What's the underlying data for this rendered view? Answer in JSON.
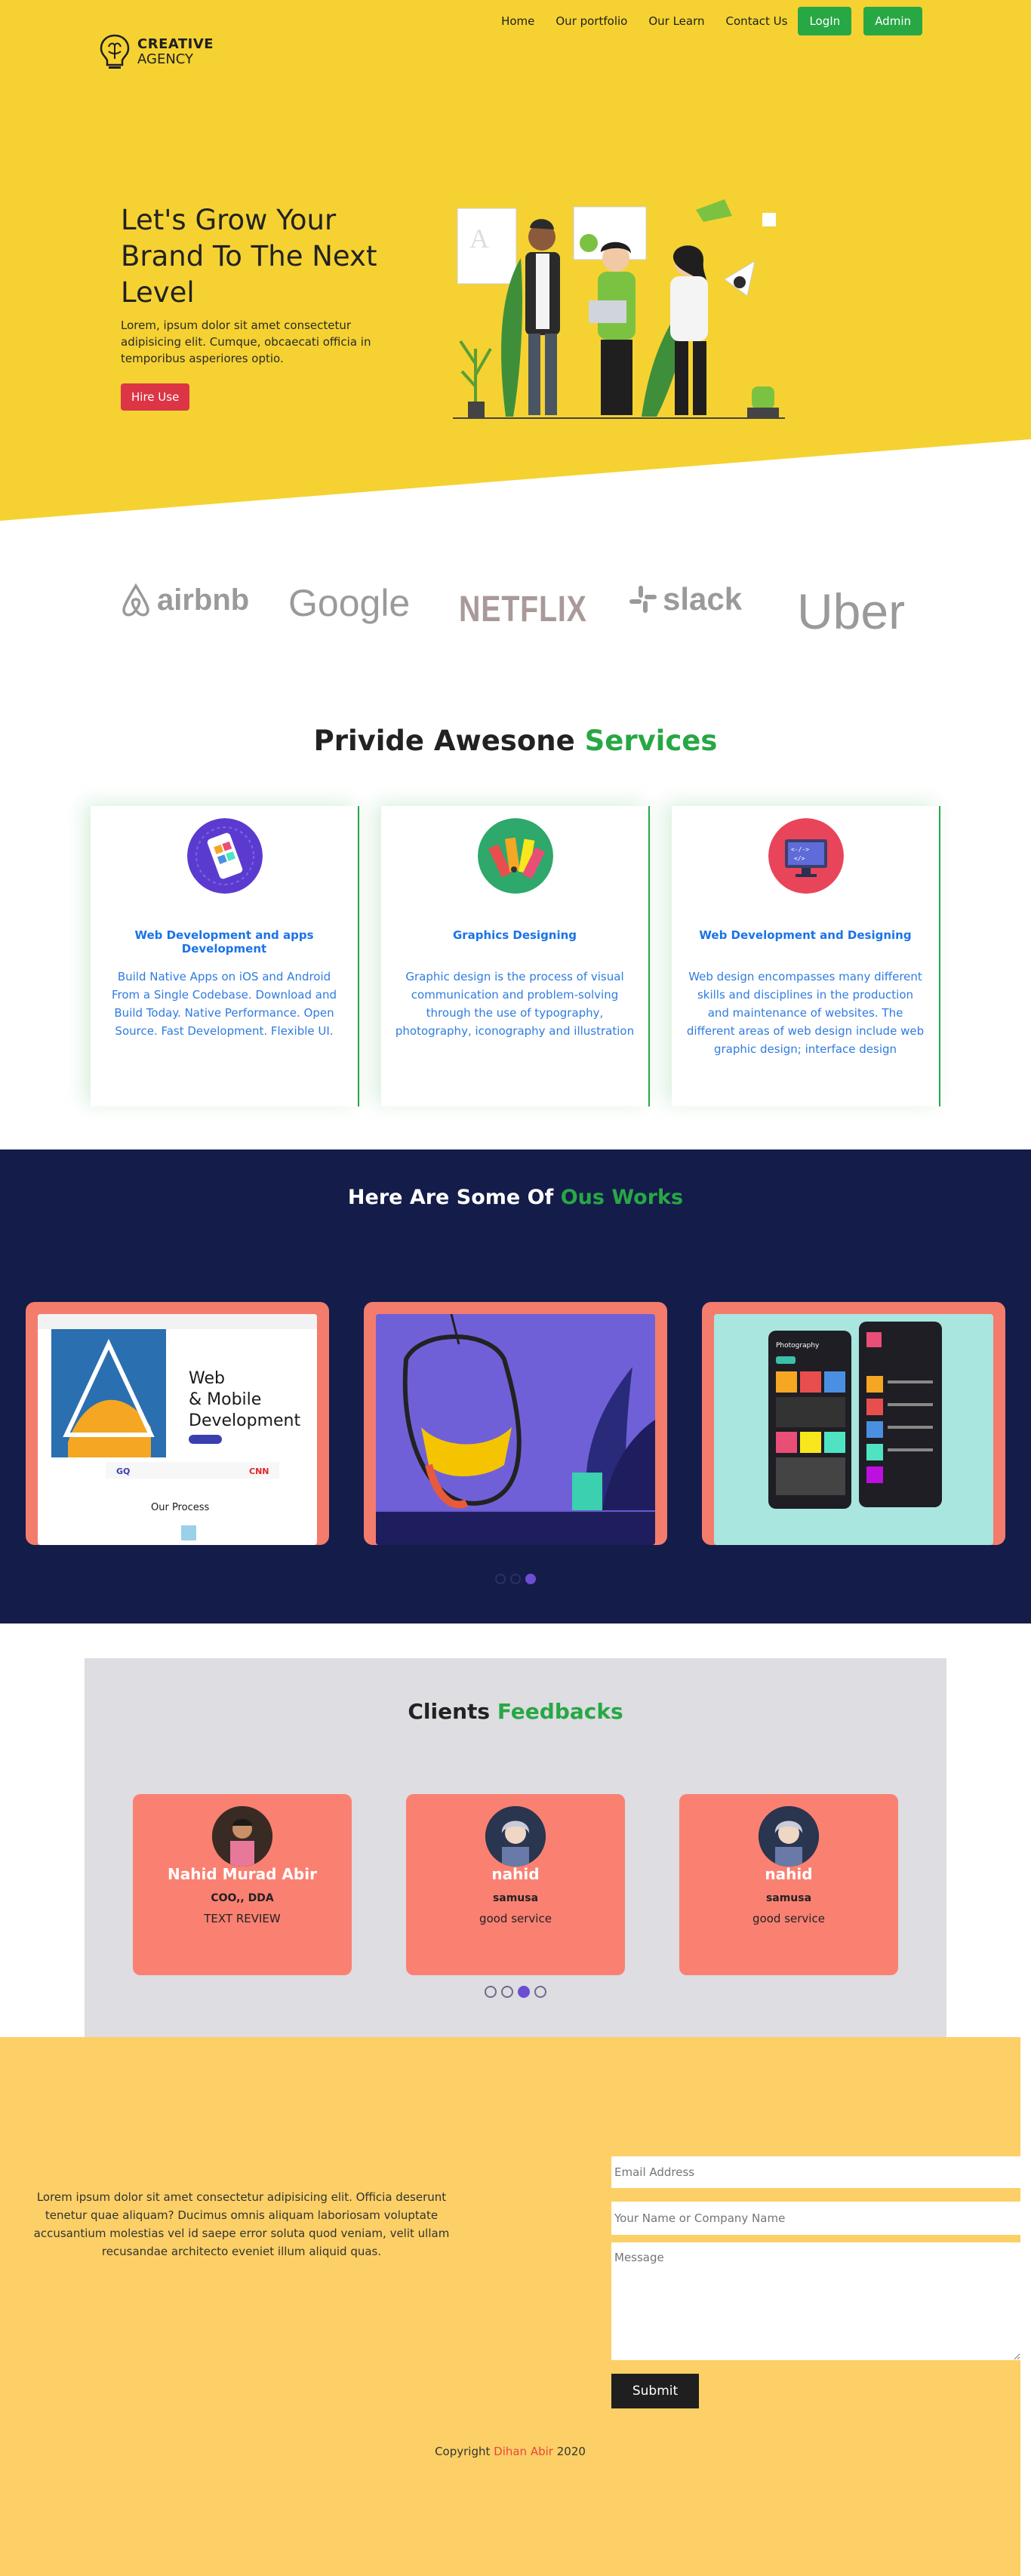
{
  "colors": {
    "hero_bg": "#f5d232",
    "accent_green": "#28a745",
    "hire_red": "#dc3545",
    "works_bg": "#141c4a",
    "card_coral": "#fa8072",
    "feedback_bg": "#dddde2",
    "footer_bg": "#fcd066",
    "service_text_blue": "#2f7be0"
  },
  "logo": {
    "line1": "CREATIVE",
    "line2": "AGENCY",
    "icon": "lightbulb-brain-icon"
  },
  "nav": {
    "items": [
      "Home",
      "Our portfolio",
      "Our Learn",
      "Contact Us"
    ],
    "login": "LogIn",
    "admin": "Admin"
  },
  "hero": {
    "title": "Let's Grow Your Brand To The Next Level",
    "text": "Lorem, ipsum dolor sit amet consectetur adipisicing elit. Cumque, obcaecati officia in temporibus asperiores optio.",
    "button": "Hire Use",
    "illustration": "team-illustration"
  },
  "brands": [
    "airbnb",
    "Google",
    "NETFLIX",
    "slack",
    "Uber"
  ],
  "services": {
    "title_part1": "Privide Awesone",
    "title_part2": "Services",
    "items": [
      {
        "icon": "mobile-app-icon",
        "title": "Web Development and apps Development",
        "text": "Build Native Apps on iOS and Android From a Single Codebase. Download and Build Today. Native Performance. Open Source. Fast Development. Flexible UI."
      },
      {
        "icon": "color-palette-icon",
        "title": "Graphics Designing",
        "text": "Graphic design is the process of visual communication and problem-solving through the use of typography, photography, iconography and illustration"
      },
      {
        "icon": "code-monitor-icon",
        "title": "Web Development and Designing",
        "text": "Web design encompasses many different skills and disciplines in the production and maintenance of websites. The different areas of web design include web graphic design; interface design"
      }
    ]
  },
  "works": {
    "title_part1": "Here Are Some Of",
    "title_part2": "Ous Works",
    "items": [
      {
        "heading": "Web & Mobile Development",
        "sub": "Our Process"
      },
      {
        "heading": "",
        "sub": ""
      },
      {
        "heading": "Photography",
        "sub": ""
      }
    ],
    "active_dot": 2
  },
  "feedback": {
    "title_part1": "Clients",
    "title_part2": "Feedbacks",
    "items": [
      {
        "name": "Nahid Murad Abir",
        "company": "COO,, DDA",
        "text": "TEXT REVIEW"
      },
      {
        "name": "nahid",
        "company": "samusa",
        "text": "good service"
      },
      {
        "name": "nahid",
        "company": "samusa",
        "text": "good service"
      }
    ],
    "active_dot": 2
  },
  "contact": {
    "text": "Lorem ipsum dolor sit amet consectetur adipisicing elit. Officia deserunt tenetur quae aliquam? Ducimus omnis aliquam laboriosam voluptate accusantium molestias vel id saepe error soluta quod veniam, velit ullam recusandae architecto eveniet illum aliquid quas.",
    "email_placeholder": "Email Address",
    "name_placeholder": "Your Name or Company Name",
    "message_placeholder": "Message",
    "submit": "Submit",
    "copyright_prefix": "Copyright",
    "copyright_author": "Dihan Abir",
    "copyright_year": "2020"
  }
}
